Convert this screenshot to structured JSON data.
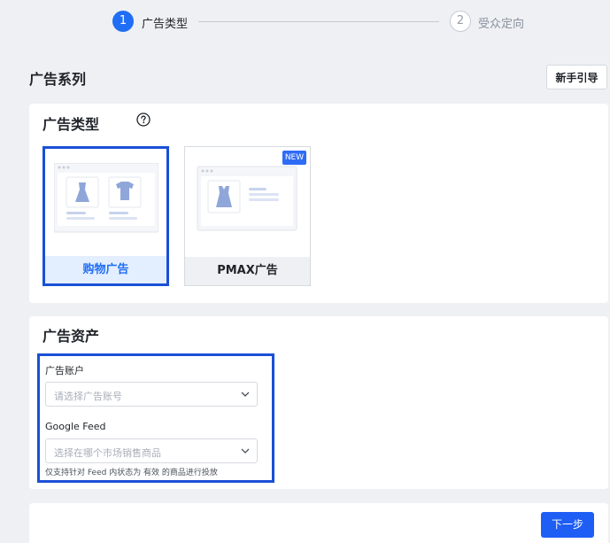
{
  "stepper": {
    "step1": {
      "number": "1",
      "label": "广告类型"
    },
    "step2": {
      "number": "2",
      "label": "受众定向"
    }
  },
  "header": {
    "title": "广告系列",
    "guide_button": "新手引导"
  },
  "ad_type": {
    "title": "广告类型",
    "help_icon": "question-circle-icon",
    "cards": [
      {
        "label": "购物广告",
        "selected": true
      },
      {
        "label": "PMAX广告",
        "badge": "NEW",
        "selected": false
      }
    ]
  },
  "assets": {
    "title": "广告资产",
    "account": {
      "label": "广告账户",
      "placeholder": "请选择广告账号"
    },
    "feed": {
      "label": "Google Feed",
      "placeholder": "选择在哪个市场销售商品"
    },
    "hint": "仅支持针对 Feed 内状态为 有效 的商品进行投放"
  },
  "footer": {
    "next_button": "下一步"
  },
  "colors": {
    "accent": "#1f6ef5",
    "highlight_border": "#1a4fd6",
    "background": "#eef0f4"
  }
}
